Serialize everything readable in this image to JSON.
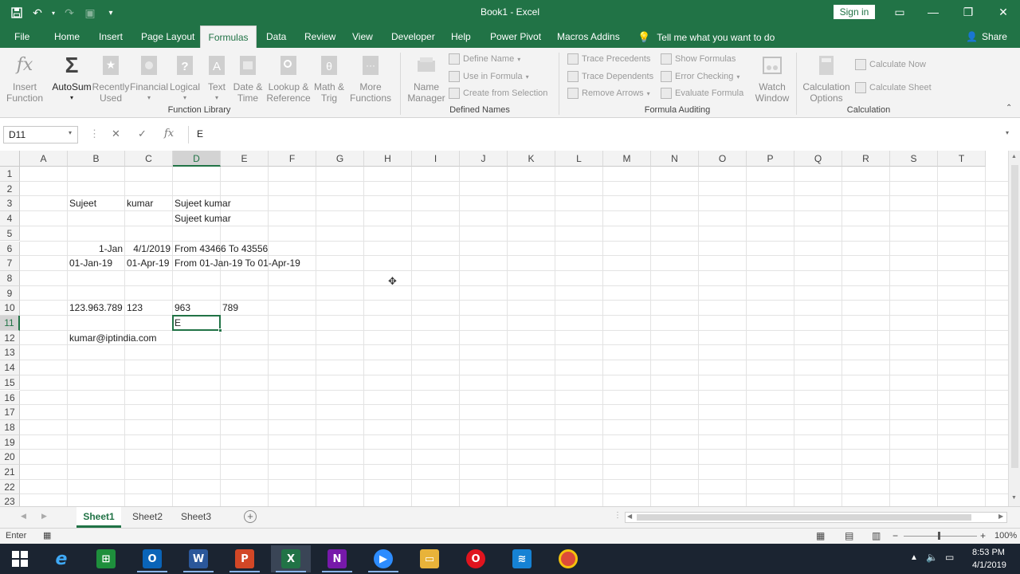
{
  "window": {
    "title": "Book1  -  Excel",
    "signin": "Sign in"
  },
  "tabs": [
    "File",
    "Home",
    "Insert",
    "Page Layout",
    "Formulas",
    "Data",
    "Review",
    "View",
    "Developer",
    "Help",
    "Power Pivot",
    "Macros Addins"
  ],
  "active_tab": "Formulas",
  "tellme": "Tell me what you want to do",
  "share": "Share",
  "ribbon": {
    "insert_function": [
      "Insert",
      "Function"
    ],
    "autosum": "AutoSum",
    "recently_used": [
      "Recently",
      "Used"
    ],
    "financial": "Financial",
    "logical": "Logical",
    "text": "Text",
    "date_time": [
      "Date &",
      "Time"
    ],
    "lookup": [
      "Lookup &",
      "Reference"
    ],
    "math": [
      "Math &",
      "Trig"
    ],
    "more": [
      "More",
      "Functions"
    ],
    "function_library": "Function Library",
    "name_manager": [
      "Name",
      "Manager"
    ],
    "define_name": "Define Name",
    "use_in_formula": "Use in Formula",
    "create_from_selection": "Create from Selection",
    "defined_names": "Defined Names",
    "trace_precedents": "Trace Precedents",
    "trace_dependents": "Trace Dependents",
    "remove_arrows": "Remove Arrows",
    "show_formulas": "Show Formulas",
    "error_checking": "Error Checking",
    "evaluate_formula": "Evaluate Formula",
    "watch_window": [
      "Watch",
      "Window"
    ],
    "formula_auditing": "Formula Auditing",
    "calc_options": [
      "Calculation",
      "Options"
    ],
    "calculate_now": "Calculate Now",
    "calculate_sheet": "Calculate Sheet",
    "calculation": "Calculation"
  },
  "formula_bar": {
    "name_box": "D11",
    "value": "E"
  },
  "columns": [
    "A",
    "B",
    "C",
    "D",
    "E",
    "F",
    "G",
    "H",
    "I",
    "J",
    "K",
    "L",
    "M",
    "N",
    "O",
    "P",
    "Q",
    "R",
    "S",
    "T"
  ],
  "rows": [
    "1",
    "2",
    "3",
    "4",
    "5",
    "6",
    "7",
    "8",
    "9",
    "10",
    "11",
    "12",
    "13",
    "14",
    "15",
    "16",
    "17",
    "18",
    "19",
    "20",
    "21",
    "22",
    "23"
  ],
  "selected_column": "D",
  "selected_row": "11",
  "cells": {
    "B3": "Sujeet",
    "C3": "kumar",
    "D3": "Sujeet kumar",
    "D4": "Sujeet kumar",
    "B6": "1-Jan",
    "C6": "4/1/2019",
    "D6": "From 43466 To 43556",
    "B7": "01-Jan-19",
    "C7": "01-Apr-19",
    "D7": "From 01-Jan-19 To 01-Apr-19",
    "B10": "123.963.789",
    "C10": "123",
    "D10": "963",
    "E10": "789",
    "D11": "E",
    "B12": "kumar@iptindia.com"
  },
  "sheets": [
    "Sheet1",
    "Sheet2",
    "Sheet3"
  ],
  "active_sheet": "Sheet1",
  "status": {
    "mode": "Enter",
    "zoom": "100%"
  },
  "taskbar": {
    "time": "8:53 PM",
    "date": "4/1/2019"
  },
  "colors": {
    "excel_green": "#217346",
    "taskbar": "#1b2431"
  }
}
